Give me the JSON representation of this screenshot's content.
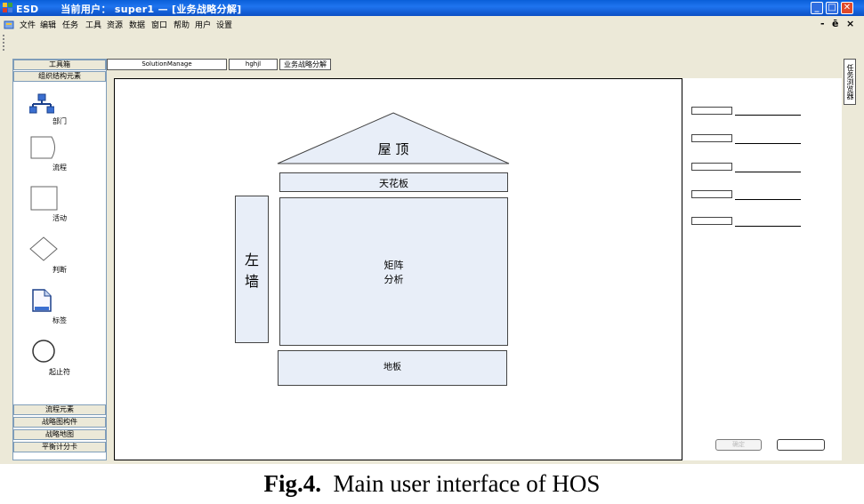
{
  "window": {
    "app_name": "ESD",
    "user_label": "当前用户：",
    "user": "super1",
    "dash": " — ",
    "doc_title": "[业务战略分解]"
  },
  "menu": {
    "items": [
      "文件",
      "编辑",
      "任务",
      "工具",
      "资源",
      "数据",
      "窗口",
      "帮助",
      "用户",
      "设置"
    ]
  },
  "toolbox": {
    "header": "工具箱",
    "top_section": "组织结构元素",
    "tools": [
      {
        "label": "部门",
        "icon": "department-icon"
      },
      {
        "label": "流程",
        "icon": "process-icon"
      },
      {
        "label": "活动",
        "icon": "activity-icon"
      },
      {
        "label": "判断",
        "icon": "decision-diamond-icon"
      },
      {
        "label": "标签",
        "icon": "label-document-icon"
      },
      {
        "label": "起止符",
        "icon": "terminator-circle-icon"
      }
    ],
    "bottom_sections": [
      "流程元素",
      "战略图构件",
      "战略地图",
      "平衡计分卡"
    ]
  },
  "tabs": [
    "SolutionManage",
    "hghjl",
    "业务战略分解"
  ],
  "side_tab": "任务浏览器",
  "house": {
    "roof": "屋 顶",
    "ceiling": "天花板",
    "left_wall_1": "左",
    "left_wall_2": "墙",
    "matrix_1": "矩阵",
    "matrix_2": "分析",
    "floor": "地板"
  },
  "panel": {
    "button_1": "确定",
    "button_2": ""
  },
  "caption": {
    "label": "Fig.4.",
    "text": "Main user interface of HOS"
  },
  "colors": {
    "title_bar": "#0b55d6",
    "house_fill": "#e8eef8",
    "close_red": "#e04a2a"
  }
}
